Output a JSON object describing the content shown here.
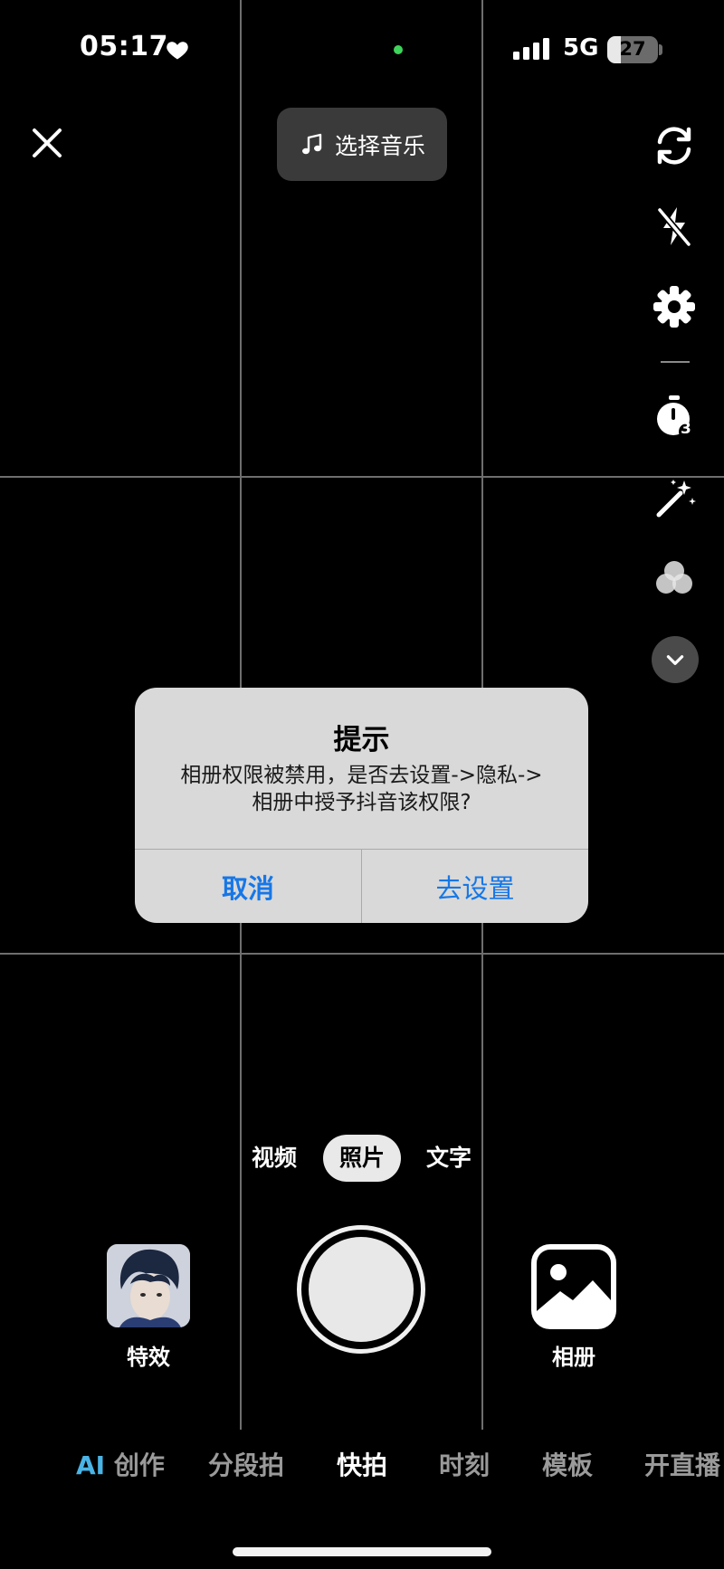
{
  "status_bar": {
    "time": "05:17",
    "network": "5G",
    "battery_level": "27",
    "battery_fraction": 0.27,
    "heart_icon": "heart-icon",
    "recording_indicator_color": "#3ed35a"
  },
  "top_bar": {
    "close_icon": "close-icon",
    "music_button_label": "选择音乐",
    "music_icon": "music-note-icon"
  },
  "tools": [
    {
      "name": "flip-camera-icon"
    },
    {
      "name": "flash-off-icon"
    },
    {
      "name": "settings-icon"
    },
    {
      "name": "timer-icon",
      "badge": "3"
    },
    {
      "name": "beauty-wand-icon"
    },
    {
      "name": "filter-icon"
    },
    {
      "name": "more-chevron-down-icon"
    }
  ],
  "dialog": {
    "title": "提示",
    "message_line1": "相册权限被禁用，是否去设置->隐私->",
    "message_line2": "相册中授予抖音该权限?",
    "cancel_label": "取消",
    "confirm_label": "去设置",
    "button_color": "#1777e6"
  },
  "modes": {
    "video": "视频",
    "photo": "照片",
    "text": "文字",
    "active": "照片"
  },
  "capture": {
    "effects_label": "特效",
    "album_label": "相册"
  },
  "bottom_nav": {
    "ai_tag": "AI",
    "ai_create": "创作",
    "segment": "分段拍",
    "quick": "快拍",
    "moments": "时刻",
    "templates": "模板",
    "live": "开直播",
    "active": "快拍",
    "ai_color": "#4ab4e6"
  }
}
